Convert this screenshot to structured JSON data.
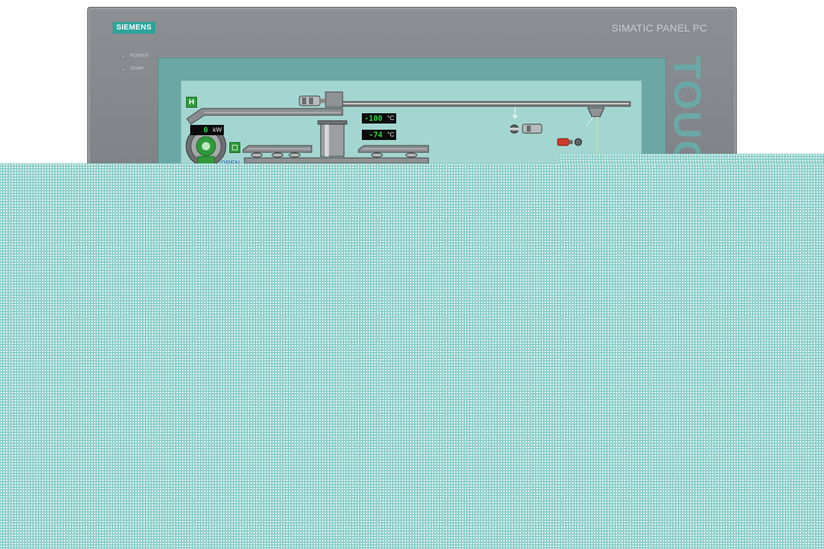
{
  "device": {
    "brand": "SIEMENS",
    "model": "SIMATIC PANEL PC",
    "touch_label": "TOUC",
    "leds": [
      {
        "label": "POWER"
      },
      {
        "label": "TEMP"
      }
    ]
  },
  "hmi": {
    "mode_badge": "H",
    "power_readout": {
      "value": "0",
      "unit": "kW"
    },
    "temperatures": [
      {
        "value": "-100",
        "unit": "°C"
      },
      {
        "value": "-74",
        "unit": "°C"
      }
    ],
    "valve_state": "OPEN"
  },
  "colors": {
    "brand": "#2aa39a",
    "screen_background": "#a3d6d1",
    "readout_text": "#2bd24b",
    "status_green": "#2e9a3a",
    "alarm_red": "#d23a2a"
  }
}
